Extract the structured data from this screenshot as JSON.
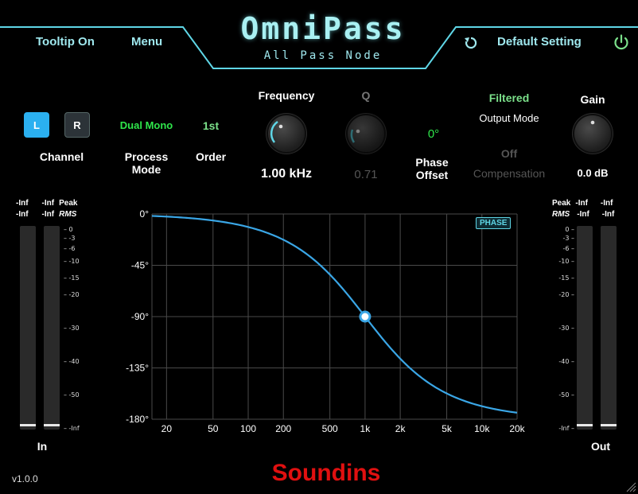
{
  "header": {
    "tooltip_label": "Tooltip On",
    "menu_label": "Menu",
    "title": "OmniPass",
    "subtitle": "All Pass Node",
    "reset_icon": "reset-icon",
    "preset_label": "Default Setting",
    "power_icon": "power-icon",
    "accent_color": "#5fd6e6"
  },
  "controls": {
    "channel": {
      "left": "L",
      "right": "R",
      "label": "Channel",
      "active": "L"
    },
    "process_mode": {
      "value": "Dual Mono",
      "label": "Process Mode"
    },
    "order": {
      "value": "1st",
      "label": "Order"
    },
    "frequency": {
      "label": "Frequency",
      "value": "1.00 kHz"
    },
    "q": {
      "label": "Q",
      "value": "0.71"
    },
    "phase_offset": {
      "value": "0°",
      "label_line1": "Phase",
      "label_line2": "Offset"
    },
    "output_mode": {
      "value": "Filtered",
      "label": "Output Mode"
    },
    "compensation": {
      "value": "Off",
      "label": "Compensation"
    },
    "gain": {
      "label": "Gain",
      "value": "0.0 dB"
    }
  },
  "meters": {
    "in": {
      "label": "In",
      "peak_l": "-Inf",
      "peak_r": "-Inf",
      "peak_label": "Peak",
      "rms_l": "-Inf",
      "rms_r": "-Inf",
      "rms_label": "RMS",
      "level_l": 0,
      "level_r": 0
    },
    "out": {
      "label": "Out",
      "peak_l": "-Inf",
      "peak_r": "-Inf",
      "peak_label": "Peak",
      "rms_l": "-Inf",
      "rms_r": "-Inf",
      "rms_label": "RMS",
      "level_l": 0,
      "level_r": 0
    },
    "scale": [
      "0",
      "-3",
      "-6",
      "-10",
      "-15",
      "-20",
      "-30",
      "-40",
      "-50",
      "-Inf"
    ]
  },
  "graph": {
    "badge": "PHASE",
    "y_ticks": [
      "0°",
      "-45°",
      "-90°",
      "-135°",
      "-180°"
    ],
    "x_ticks": [
      "20",
      "50",
      "100",
      "200",
      "500",
      "1k",
      "2k",
      "5k",
      "10k",
      "20k"
    ],
    "curve_color": "#3aa6e6",
    "marker_freq_hz": 1000,
    "marker_phase_deg": -90
  },
  "footer": {
    "version": "v1.0.0",
    "brand": "Soundins"
  }
}
